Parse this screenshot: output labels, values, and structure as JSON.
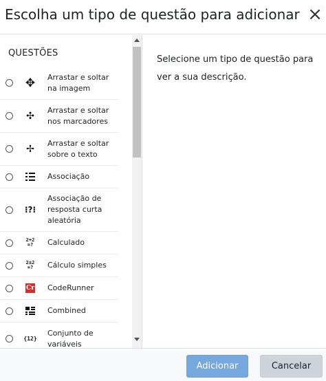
{
  "dialog": {
    "title": "Escolha um tipo de questão para adicionar",
    "close_glyph": "×"
  },
  "left_pane": {
    "section_title": "QUESTÕES",
    "options": [
      {
        "label": "Arrastar e soltar na imagem",
        "icon": "move-cross-icon",
        "glyph": "✥",
        "selected": false
      },
      {
        "label": "Arrastar e soltar nos marcadores",
        "icon": "move-markers-icon",
        "glyph": "✣",
        "selected": false
      },
      {
        "label": "Arrastar e soltar sobre o texto",
        "icon": "move-text-icon",
        "glyph": "✢",
        "selected": false
      },
      {
        "label": "Associação",
        "icon": "list-match-icon",
        "glyph": "⠿",
        "selected": false
      },
      {
        "label": "Associação de resposta curta aleatória",
        "icon": "random-match-icon",
        "glyph": "⁝?⁝",
        "selected": false
      },
      {
        "label": "Calculado",
        "icon": "calculated-icon",
        "glyph": "2+2 =?",
        "selected": false
      },
      {
        "label": "Cálculo simples",
        "icon": "calculated-simple-icon",
        "glyph": "2±2 =?",
        "selected": false
      },
      {
        "label": "CodeRunner",
        "icon": "coderunner-icon",
        "glyph": "Cr",
        "selected": false
      },
      {
        "label": "Combined",
        "icon": "combined-icon",
        "glyph": "▦",
        "selected": false
      },
      {
        "label": "Conjunto de variáveis",
        "icon": "dataset-icon",
        "glyph": "{12}",
        "selected": false
      }
    ]
  },
  "right_pane": {
    "description": "Selecione um tipo de questão para ver a sua descrição."
  },
  "footer": {
    "add_label": "Adicionar",
    "cancel_label": "Cancelar"
  },
  "colors": {
    "primary_button": "#76a7dd",
    "secondary_button": "#ced4da",
    "coderunner_red": "#d32f2f"
  }
}
